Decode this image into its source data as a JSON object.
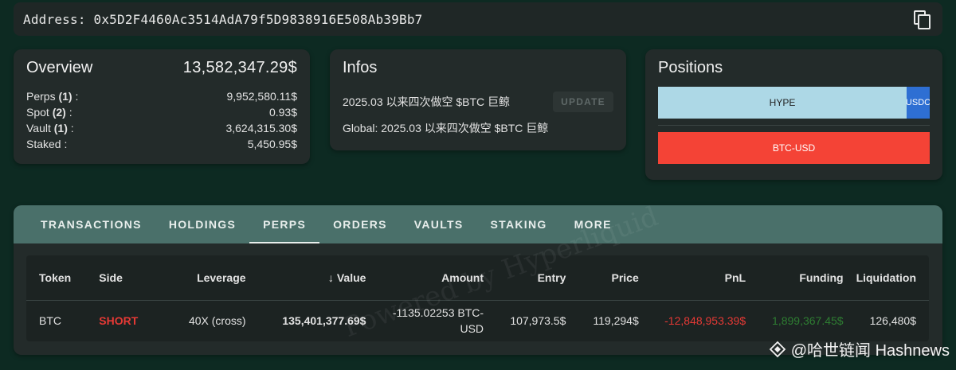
{
  "address": {
    "label": "Address:",
    "value": "0x5D2F4460Ac3514AdA79f5D9838916E508Ab39Bb7"
  },
  "overview": {
    "title": "Overview",
    "total": "13,582,347.29$",
    "rows": [
      {
        "label": "Perps",
        "count": "(1)",
        "suffix": " :",
        "value": "9,952,580.11$"
      },
      {
        "label": "Spot",
        "count": "(2)",
        "suffix": " :",
        "value": "0.93$"
      },
      {
        "label": "Vault",
        "count": "(1)",
        "suffix": " :",
        "value": "3,624,315.30$"
      },
      {
        "label": "Staked",
        "count": "",
        "suffix": " :",
        "value": "5,450.95$"
      }
    ]
  },
  "infos": {
    "title": "Infos",
    "line1": "2025.03 以来四次做空 $BTC 巨鲸",
    "line2": "Global: 2025.03 以来四次做空 $BTC 巨鲸",
    "update_label": "UPDATE"
  },
  "positions": {
    "title": "Positions",
    "bars": [
      {
        "label": "HYPE",
        "color": "#add8e6",
        "share": 0.915
      },
      {
        "label": "USDC",
        "color": "#2e6fd3",
        "share": 0.085
      }
    ],
    "btc_label": "BTC-USD",
    "btc_color": "#f44336"
  },
  "tabs": [
    "TRANSACTIONS",
    "HOLDINGS",
    "PERPS",
    "ORDERS",
    "VAULTS",
    "STAKING",
    "MORE"
  ],
  "active_tab": "PERPS",
  "table": {
    "headers": [
      "Token",
      "Side",
      "Leverage",
      "Value",
      "Amount",
      "Entry",
      "Price",
      "PnL",
      "Funding",
      "Liquidation"
    ],
    "sort_icon": "arrow-down-icon",
    "rows": [
      {
        "token": "BTC",
        "side": "SHORT",
        "leverage": "40X (cross)",
        "value": "135,401,377.69$",
        "amount": "-1135.02253 BTC-USD",
        "entry": "107,973.5$",
        "price": "119,294$",
        "pnl": "-12,848,953.39$",
        "funding": "1,899,367.45$",
        "liquidation": "126,480$"
      }
    ]
  },
  "watermark": "Powered by Hyperliquid",
  "credit": "@哈世链闻 Hashnews"
}
